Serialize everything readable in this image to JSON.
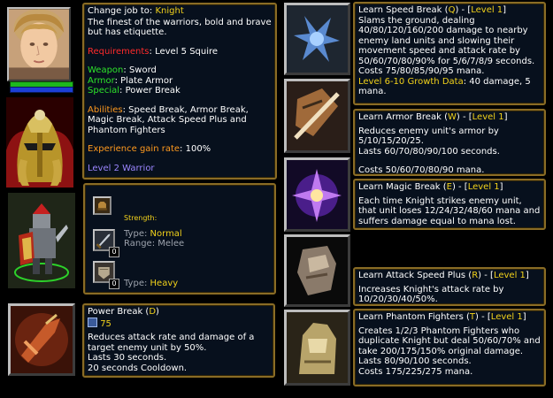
{
  "job": {
    "change_label": "Change job to:",
    "name": "Knight",
    "description": "The finest of the warriors, bold and brave but has etiquette.",
    "requirements_label": "Requirements",
    "requirements_value": "Level 5 Squire",
    "weapon_label": "Weapon",
    "weapon_value": "Sword",
    "armor_label": "Armor",
    "armor_value": "Plate Armor",
    "special_label": "Special",
    "special_value": "Power Break",
    "abilities_label": "Abilities",
    "abilities_value": "Speed Break, Armor Break, Magic Break, Attack Speed Plus and Phantom Fighters",
    "exp_label": "Experience gain rate",
    "exp_value": "100%",
    "next_job": "Level 2 Warrior"
  },
  "stats": {
    "strength_label": "Strength:",
    "weapon_type_label": "Type:",
    "weapon_type_value": "Normal",
    "range_label": "Range:",
    "range_value": "Melee",
    "attack_upgrade": "0",
    "armor_type_label": "Type:",
    "armor_type_value": "Heavy",
    "armor_upgrade": "0"
  },
  "power_break": {
    "title": "Power Break",
    "hotkey": "D",
    "cost": "75",
    "description": "Reduces attack rate and damage of a target enemy unit by 50%.",
    "duration": "Lasts 30 seconds.",
    "cooldown": "20 seconds Cooldown."
  },
  "abilities": [
    {
      "learn": "Learn Speed Break",
      "hotkey": "Q",
      "level": "Level 1",
      "desc": "Slams the ground, dealing 40/80/120/160/200 damage to nearby enemy land units and slowing their movement speed and attack rate by 50/60/70/80/90% for 5/6/7/8/9 seconds.",
      "cost": "Costs 75/80/85/90/95 mana.",
      "growth_label": "Level 6-10 Growth Data",
      "growth_value": "40 damage, 5 mana."
    },
    {
      "learn": "Learn Armor Break",
      "hotkey": "W",
      "level": "Level 1",
      "desc": "Reduces enemy unit's armor by 5/10/15/20/25.",
      "duration": "Lasts 60/70/80/90/100 seconds.",
      "cost": "Costs 50/60/70/80/90 mana."
    },
    {
      "learn": "Learn Magic Break",
      "hotkey": "E",
      "level": "Level 1",
      "desc": "Each time Knight strikes enemy unit, that unit loses 12/24/32/48/60 mana and suffers damage equal to mana lost."
    },
    {
      "learn": "Learn Attack Speed Plus",
      "hotkey": "R",
      "level": "Level 1",
      "desc": "Increases Knight's attack rate by 10/20/30/40/50%."
    },
    {
      "learn": "Learn Phantom Fighters",
      "hotkey": "T",
      "level": "Level 1",
      "desc": "Creates 1/2/3 Phantom Fighters who duplicate Knight but deal 50/60/70% and take 200/175/150% original damage.",
      "duration": "Lasts 80/90/100 seconds.",
      "cost": "Costs 175/225/275 mana."
    }
  ],
  "portrait": {
    "health_pct": 100,
    "mana_pct": 100,
    "health_color": "#1db81d",
    "mana_color": "#1c3fd6"
  },
  "colors": {
    "gold": "#f2d21b",
    "border": "#8a6c25",
    "panel": "#07101d"
  },
  "icons": [
    "hero-portrait",
    "knight-portrait",
    "knight-unit-model",
    "strength-icon",
    "sword-icon",
    "armor-icon",
    "power-break-icon",
    "mana-icon",
    "speed-break-icon",
    "armor-break-icon",
    "magic-break-icon",
    "attack-speed-plus-icon",
    "phantom-fighters-icon"
  ]
}
